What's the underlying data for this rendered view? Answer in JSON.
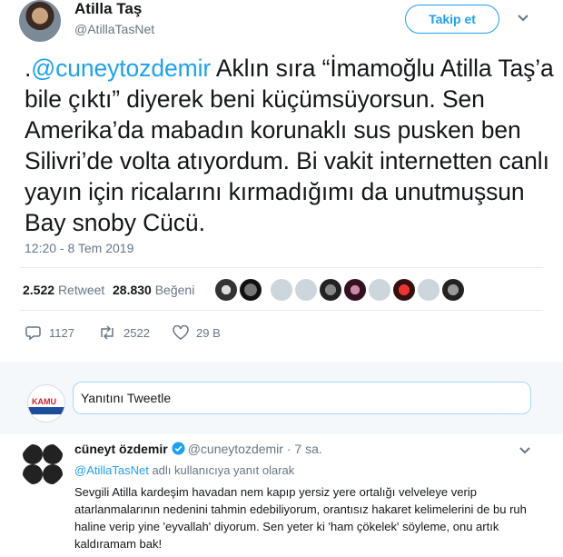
{
  "tweet": {
    "author_name": "Atilla Taş",
    "author_handle": "@AtillaTasNet",
    "follow_label": "Takip et",
    "text_prefix": ".",
    "text_mention": "@cuneytozdemir",
    "text_body": " Aklın sıra “İmamoğlu Atilla Taş’a bile çıktı” diyerek beni küçümsüyorsun. Sen Amerika’da mabadın korunaklı sus pusken ben Silivri’de volta atıyordum. Bi vakit internetten canlı yayın için ricalarını kırmadığımı da unutmuşsun Bay snoby Cücü.",
    "timestamp": "12:20 - 8 Tem 2019",
    "retweet_count": "2.522",
    "retweet_label": "Retweet",
    "like_count": "28.830",
    "like_label": "Beğeni",
    "reply_action_count": "1127",
    "retweet_action_count": "2522",
    "like_action_count": "29 B"
  },
  "reply_box": {
    "placeholder": "Yanıtını Tweetle",
    "logo_text": "KAMU"
  },
  "reply": {
    "author_name": "cüneyt özdemir",
    "author_handle": "@cuneytozdemir",
    "time": "· 7 sa.",
    "replying_mention": "@AtillaTasNet",
    "replying_suffix": " adlı kullanıcıya yanıt olarak",
    "text": "Sevgili Atilla kardeşim havadan nem kapıp yersiz yere ortalığı velveleye verip atarlanmalarının nedenini tahmin edebiliyorum, orantısız hakaret kelimelerini de bu ruh haline verip yine 'eyvallah' diyorum. Sen yeter ki 'ham çökelek' söyleme, onu artık kaldıramam bak!"
  },
  "colors": {
    "accent": "#1da1f2",
    "muted": "#657786",
    "reply_bar_bg": "#f5f8fa"
  },
  "icons": [
    "chevron-down-icon",
    "reply-icon",
    "retweet-icon",
    "heart-icon",
    "verified-icon"
  ]
}
